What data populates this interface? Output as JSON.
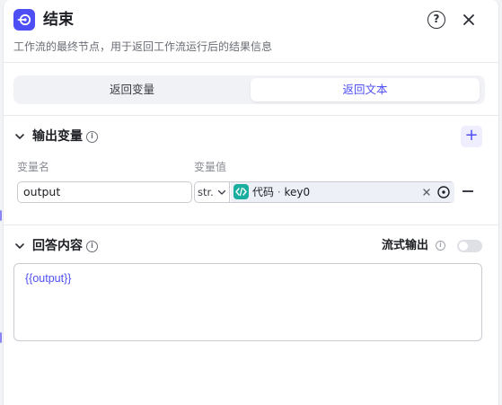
{
  "node": {
    "title": "结束",
    "description": "工作流的最终节点，用于返回工作流运行后的结果信息"
  },
  "tabs": [
    {
      "label": "返回变量",
      "selected": false
    },
    {
      "label": "返回文本",
      "selected": true
    }
  ],
  "output_section": {
    "title": "输出变量",
    "columns": {
      "name": "变量名",
      "value": "变量值"
    },
    "rows": [
      {
        "name": "output",
        "type": "str.",
        "ref_source": "代码",
        "ref_separator": " · ",
        "ref_key": "key0"
      }
    ]
  },
  "answer_section": {
    "title": "回答内容",
    "stream_label": "流式输出",
    "stream_enabled": false,
    "content": "{{output}}"
  },
  "colors": {
    "accent": "#4e4ef5",
    "code_icon": "#1aaea0"
  }
}
